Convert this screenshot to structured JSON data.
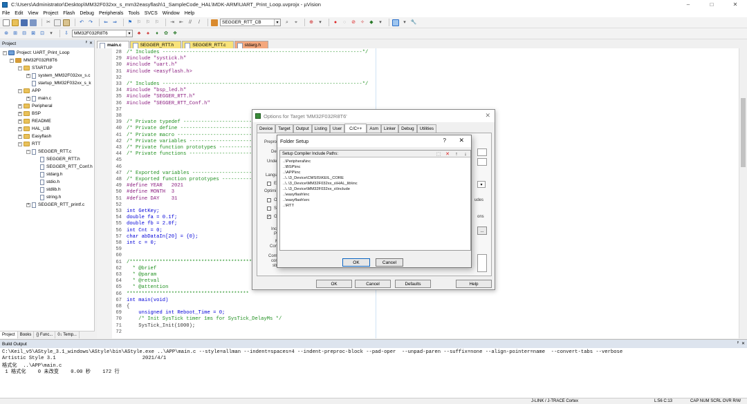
{
  "window": {
    "title": "C:\\Users\\Administrator\\Desktop\\MM32F032xx_s_mm32easyflash\\1_SampleCode_HAL\\MDK-ARM\\UART_Print_Loop.uvprojx - µVision",
    "minimize": "–",
    "maximize": "□",
    "close": "✕"
  },
  "menu": [
    "File",
    "Edit",
    "View",
    "Project",
    "Flash",
    "Debug",
    "Peripherals",
    "Tools",
    "SVCS",
    "Window",
    "Help"
  ],
  "toolbar": {
    "target_combo": "SEGGER_RTT_CB",
    "project_combo": "MM32F032R8T6"
  },
  "project_panel": {
    "header": "Project",
    "pin": "ᵖ",
    "close": "✕",
    "root": "Project: UART_Print_Loop",
    "target": "MM32F032R8T6",
    "groups": {
      "startup": "STARTUP",
      "startup_file1": "system_MM32F032xx_s.c",
      "startup_file2": "startup_MM32F032xx_s_k",
      "app": "APP",
      "app_file": "main.c",
      "peripheral": "Peripheral",
      "bsp": "BSP",
      "readme": "README",
      "hal_lib": "HAL_LIB",
      "easyflash": "Easyflash",
      "rtt": "RTT",
      "rtt_c": "SEGGER_RTT.c",
      "rtt_h": "SEGGER_RTT.h",
      "rtt_conf": "SEGGER_RTT_Conf.h",
      "stdarg": "stdarg.h",
      "stdio": "stdio.h",
      "stdlib": "stdlib.h",
      "string": "string.h",
      "printf": "SEGGER_RTT_printf.c"
    },
    "tabs": [
      "Project",
      "Books",
      "{} Func...",
      "0↓ Temp..."
    ]
  },
  "editor_tabs": [
    "main.c",
    "SEGGER_RTT.h",
    "SEGGER_RTT.c",
    "stdarg.h"
  ],
  "code_lines": [
    {
      "n": "28",
      "t": "/* Includes -------------------------------------------------------------------*/",
      "c": "cm"
    },
    {
      "n": "29",
      "t": "#include \"systick.h\"",
      "c": "pp"
    },
    {
      "n": "30",
      "t": "#include \"uart.h\"",
      "c": "pp"
    },
    {
      "n": "31",
      "t": "#include <easyflash.h>",
      "c": "pp"
    },
    {
      "n": "32",
      "t": "",
      "c": "plain"
    },
    {
      "n": "33",
      "t": "/* Includes -------------------------------------------------------------------*/",
      "c": "cm"
    },
    {
      "n": "34",
      "t": "#include \"bsp_led.h\"",
      "c": "pp"
    },
    {
      "n": "35",
      "t": "#include \"SEGGER_RTT.h\"",
      "c": "pp"
    },
    {
      "n": "36",
      "t": "#include \"SEGGER_RTT_Conf.h\"",
      "c": "pp"
    },
    {
      "n": "37",
      "t": "",
      "c": "plain"
    },
    {
      "n": "38",
      "t": "",
      "c": "plain"
    },
    {
      "n": "39",
      "t": "/* Private typedef ------------------------",
      "c": "cm"
    },
    {
      "n": "40",
      "t": "/* Private define -------------------------",
      "c": "cm"
    },
    {
      "n": "41",
      "t": "/* Private macro --------------------------",
      "c": "cm"
    },
    {
      "n": "42",
      "t": "/* Private variables ----------------------",
      "c": "cm"
    },
    {
      "n": "43",
      "t": "/* Private function prototypes ------------",
      "c": "cm"
    },
    {
      "n": "44",
      "t": "/* Private functions ----------------------",
      "c": "cm"
    },
    {
      "n": "45",
      "t": "",
      "c": "plain"
    },
    {
      "n": "46",
      "t": "",
      "c": "plain"
    },
    {
      "n": "47",
      "t": "/* Exported variables ---------------------",
      "c": "cm"
    },
    {
      "n": "48",
      "t": "/* Exported function prototypes -----------",
      "c": "cm"
    },
    {
      "n": "49",
      "t": "#define YEAR   2021",
      "c": "pp"
    },
    {
      "n": "50",
      "t": "#define MONTH  3",
      "c": "pp"
    },
    {
      "n": "51",
      "t": "#define DAY    31",
      "c": "pp"
    },
    {
      "n": "52",
      "t": "",
      "c": "plain"
    },
    {
      "n": "53",
      "t": "int GetKey;",
      "c": "kw"
    },
    {
      "n": "54",
      "t": "double fa = 0.1f;",
      "c": "kw"
    },
    {
      "n": "55",
      "t": "double fb = 2.0f;",
      "c": "kw"
    },
    {
      "n": "56",
      "t": "int Cnt = 0;",
      "c": "kw"
    },
    {
      "n": "57",
      "t": "char abDataIn[20] = {0};",
      "c": "kw"
    },
    {
      "n": "58",
      "t": "int c = 0;",
      "c": "kw"
    },
    {
      "n": "59",
      "t": "",
      "c": "plain"
    },
    {
      "n": "60",
      "t": "",
      "c": "plain"
    },
    {
      "n": "61",
      "t": "/*****************************************",
      "c": "cm"
    },
    {
      "n": "62",
      "t": "  * @brief",
      "c": "cm"
    },
    {
      "n": "63",
      "t": "  * @param",
      "c": "cm"
    },
    {
      "n": "64",
      "t": "  * @retval",
      "c": "cm"
    },
    {
      "n": "65",
      "t": "  * @attention",
      "c": "cm"
    },
    {
      "n": "66",
      "t": "*****************************************",
      "c": "cm"
    },
    {
      "n": "67",
      "t": "int main(void)",
      "c": "kw"
    },
    {
      "n": "68",
      "t": "{",
      "c": "plain"
    },
    {
      "n": "69",
      "t": "    unsigned int Reboot_Time = 0;",
      "c": "kw"
    },
    {
      "n": "70",
      "t": "    /* Init SysTick timer 1ms for SysTick_DelayMs */",
      "c": "cm"
    },
    {
      "n": "71",
      "t": "    SysTick_Init(1000);",
      "c": "plain"
    },
    {
      "n": "72",
      "t": "",
      "c": "plain"
    }
  ],
  "options_dialog": {
    "title": "Options for Target 'MM32F032R8T6'",
    "close": "✕",
    "tabs": [
      "Device",
      "Target",
      "Output",
      "Listing",
      "User",
      "C/C++",
      "Asm",
      "Linker",
      "Debug",
      "Utilities"
    ],
    "labels": {
      "prepro": "Prepro",
      "de": "De",
      "under": "Under",
      "langu": "Langu",
      "ex": "Ex",
      "optimi": "Optimi",
      "op": "Op",
      "sp": "Sp",
      "on": "On",
      "inclu": "Inclu",
      "pa": "Pa",
      "m": "M",
      "contr": "Contr",
      "comp": "Comp",
      "con": "con",
      "str": "str",
      "udes": "udes",
      "ons": "ons"
    },
    "buttons": {
      "ok": "OK",
      "cancel": "Cancel",
      "defaults": "Defaults",
      "help": "Help",
      "browse": "..."
    }
  },
  "folder_dialog": {
    "title": "Folder Setup",
    "help": "?",
    "close": "✕",
    "list_header": "Setup Compiler Include Paths:",
    "icons": {
      "new": "⬚",
      "delete": "✕",
      "up": "↑",
      "down": "↓"
    },
    "paths": [
      "..\\Peripheral\\inc",
      "..\\BSP\\inc",
      "..\\APP\\inc",
      "..\\..\\3_Device\\CMSIS\\KEIL_CORE",
      "..\\..\\3_Device\\MM32F032xx_s\\HAL_lib\\inc",
      "..\\..\\3_Device\\MM32F032xx_s\\Include",
      "..\\easyflash\\inc",
      "..\\easyflash\\src",
      "..\\RTT"
    ],
    "buttons": {
      "ok": "OK",
      "cancel": "Cancel"
    }
  },
  "build_output": {
    "header": "Build Output",
    "lines": [
      "C:\\Keil_v5\\AStyle_3.1_windows\\AStyle\\bin\\AStyle.exe ..\\APP\\main.c --style=allman --indent=spaces=4 --indent-preproc-block --pad-oper  --unpad-paren --suffix=none --align-pointer=name  --convert-tabs --verbose",
      "Artistic Style 3.1                             2021/4/1",
      "格式化  ..\\APP\\main.c",
      " 1 格式化    0 未改变    0.00 秒    172 行"
    ]
  },
  "status": {
    "debugger": "J-LINK / J-TRACE Cortex",
    "position": "L:56 C:13",
    "flags": "CAP  NUM  SCRL  OVR  R/W"
  }
}
